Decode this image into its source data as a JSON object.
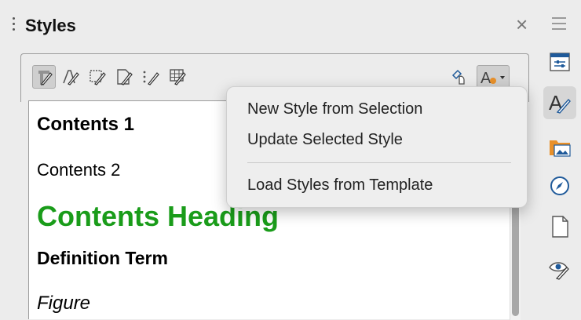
{
  "panel": {
    "title": "Styles",
    "close_glyph": "×"
  },
  "toolbar": {
    "buttons": [
      {
        "icon": "paragraph-styles-icon",
        "active": true
      },
      {
        "icon": "character-styles-icon"
      },
      {
        "icon": "frame-styles-icon"
      },
      {
        "icon": "page-styles-icon"
      },
      {
        "icon": "list-styles-icon"
      },
      {
        "icon": "table-styles-icon"
      },
      {
        "icon": "fill-format-mode-icon"
      },
      {
        "icon": "styles-actions-icon"
      }
    ]
  },
  "styles_list": [
    {
      "label": "Contents 1"
    },
    {
      "label": "Contents 2"
    },
    {
      "label": "Contents Heading"
    },
    {
      "label": "Definition Term"
    },
    {
      "label": "Figure"
    }
  ],
  "context_menu": {
    "items": [
      {
        "label": "New Style from Selection"
      },
      {
        "label": "Update Selected Style"
      },
      {
        "label": "Load Styles from Template"
      }
    ]
  },
  "sidebar": {
    "buttons": [
      {
        "icon": "properties-icon"
      },
      {
        "icon": "styles-icon",
        "active": true
      },
      {
        "icon": "gallery-icon"
      },
      {
        "icon": "navigator-icon"
      },
      {
        "icon": "page-icon"
      },
      {
        "icon": "style-inspector-icon"
      }
    ]
  },
  "colors": {
    "heading_green": "#1a9c1a",
    "accent_orange": "#e8902a",
    "icon_blue": "#1f5a9a"
  }
}
